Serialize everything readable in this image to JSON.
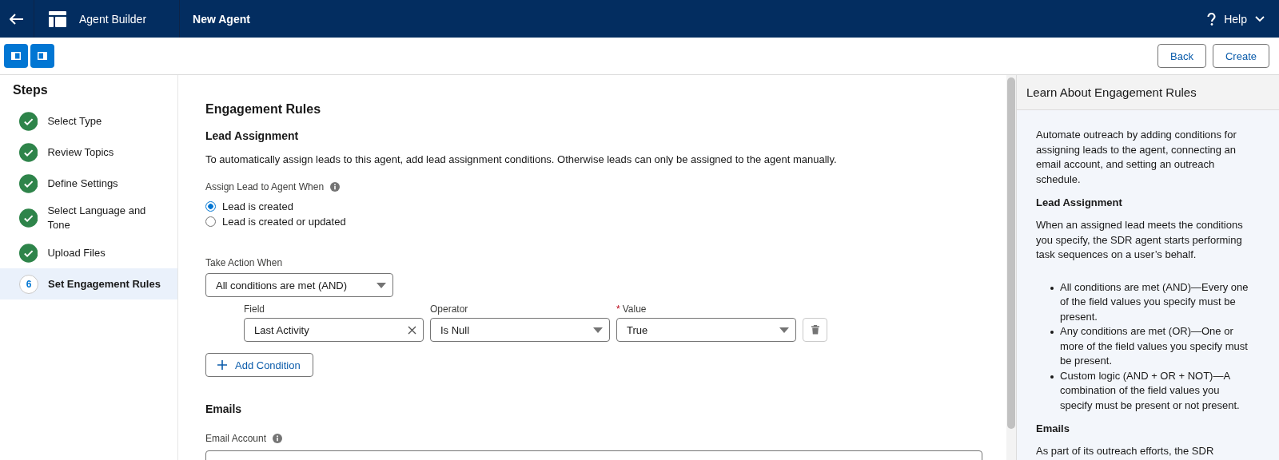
{
  "header": {
    "app_name": "Agent Builder",
    "page_title": "New Agent",
    "help_label": "Help"
  },
  "toolbar": {
    "buttons": [
      "Back",
      "Create"
    ]
  },
  "steps": {
    "title": "Steps",
    "items": [
      {
        "label": "Select Type",
        "completed": true,
        "selected": false
      },
      {
        "label": "Review Topics",
        "completed": true,
        "selected": false
      },
      {
        "label": "Define Settings",
        "completed": true,
        "selected": false
      },
      {
        "label": "Select Language and Tone",
        "completed": true,
        "selected": false
      },
      {
        "label": "Upload Files",
        "completed": true,
        "selected": false
      },
      {
        "label": "Set Engagement Rules",
        "number": "6",
        "completed": false,
        "selected": true
      }
    ]
  },
  "main": {
    "title": "Engagement Rules",
    "lead_assignment": {
      "title": "Lead Assignment",
      "description": "To automatically assign leads to this agent, add lead assignment conditions. Otherwise leads can only be assigned to the agent manually.",
      "assign_label": "Assign Lead to Agent When",
      "options": [
        {
          "label": "Lead is created",
          "selected": true
        },
        {
          "label": "Lead is created or updated",
          "selected": false
        }
      ],
      "take_action_label": "Take Action When",
      "take_action_value": "All conditions are met (AND)",
      "condition_headers": {
        "field": "Field",
        "operator": "Operator",
        "value": "Value",
        "required_mark": "*"
      },
      "conditions": [
        {
          "field": "Last Activity",
          "operator": "Is Null",
          "value": "True"
        }
      ],
      "add_button": "Add Condition"
    },
    "emails": {
      "title": "Emails",
      "email_account_label": "Email Account"
    }
  },
  "help_panel": {
    "title": "Learn About Engagement Rules",
    "blocks": [
      {
        "kind": "paragraph",
        "text": "Automate outreach by adding conditions for assigning leads to the agent, connecting an email account, and setting an outreach schedule."
      },
      {
        "kind": "heading",
        "text": "Lead Assignment"
      },
      {
        "kind": "paragraph",
        "text": "When an assigned lead meets the conditions you specify, the SDR agent starts performing task sequences on a user’s behalf."
      },
      {
        "kind": "list",
        "items": [
          "All conditions are met (AND)—Every one of the field values you specify must be present.",
          "Any conditions are met (OR)—One or more of the field values you specify must be present.",
          "Custom logic (AND + OR + NOT)—A combination of the field values you specify must be present or not present."
        ]
      },
      {
        "kind": "heading",
        "text": "Emails"
      },
      {
        "kind": "paragraph",
        "text": "As part of its outreach efforts, the SDR"
      }
    ]
  }
}
